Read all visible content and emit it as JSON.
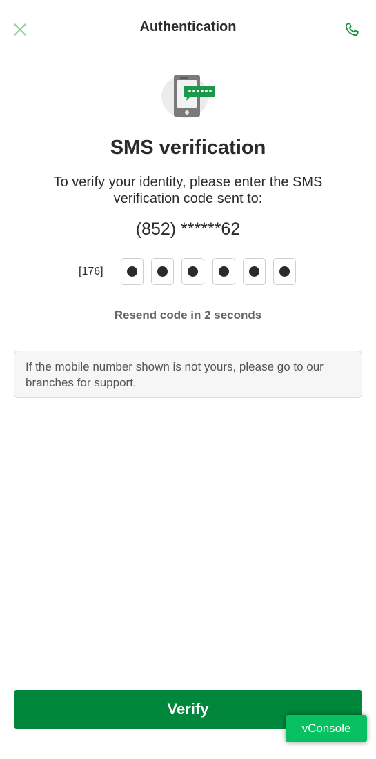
{
  "header": {
    "title": "Authentication",
    "close_icon": "close-icon",
    "phone_icon": "phone-icon"
  },
  "illustration": {
    "icon": "sms-phone-illustration"
  },
  "main": {
    "title": "SMS verification",
    "instructions": "To verify your identity, please enter the SMS verification code sent to:",
    "phone_number": "(852) ******62"
  },
  "otp": {
    "prefix": "[176]",
    "digit_count": 6,
    "filled_count": 6
  },
  "resend_text": "Resend code in 2 seconds",
  "notice_text": "If the mobile number shown is not yours, please go to our branches for support.",
  "verify_label": "Verify",
  "vconsole_label": "vConsole",
  "colors": {
    "primary_green": "#00873c",
    "icon_green": "#1a8a3e",
    "close_green": "#8ccf9b",
    "vconsole_green": "#07c160"
  }
}
